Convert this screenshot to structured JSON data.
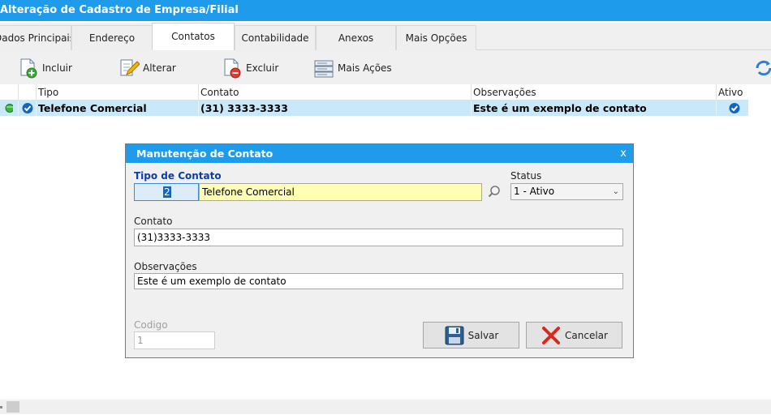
{
  "window": {
    "title": "Alteração de Cadastro de Empresa/Filial"
  },
  "tabs": [
    {
      "label": "Dados Principais"
    },
    {
      "label": "Endereço"
    },
    {
      "label": "Contatos"
    },
    {
      "label": "Contabilidade"
    },
    {
      "label": "Anexos"
    },
    {
      "label": "Mais Opções"
    }
  ],
  "active_tab": "Contatos",
  "toolbar": {
    "incluir": "Incluir",
    "alterar": "Alterar",
    "excluir": "Excluir",
    "mais_acoes": "Mais Ações"
  },
  "grid": {
    "columns": [
      "Tipo",
      "Contato",
      "Observações",
      "Ativo"
    ],
    "rows": [
      {
        "tipo": "Telefone Comercial",
        "contato": "(31) 3333-3333",
        "observacoes": "Este é um exemplo de contato",
        "ativo": true
      }
    ]
  },
  "dialog": {
    "title": "Manutenção de Contato",
    "close": "x",
    "tipo_label": "Tipo de Contato",
    "tipo_code": "2",
    "tipo_desc": "Telefone Comercial",
    "status_label": "Status",
    "status_value": "1 - Ativo",
    "contato_label": "Contato",
    "contato_value": "(31)3333-3333",
    "obs_label": "Observações",
    "obs_value": "Este é um exemplo de contato",
    "codigo_label": "Codigo",
    "codigo_value": "1",
    "salvar": "Salvar",
    "cancelar": "Cancelar"
  },
  "colors": {
    "titlebar": "#1e9bea",
    "selected_row": "#c9e9fb",
    "required_label": "#0b3ea8",
    "lookup_field": "#ffffb3"
  }
}
